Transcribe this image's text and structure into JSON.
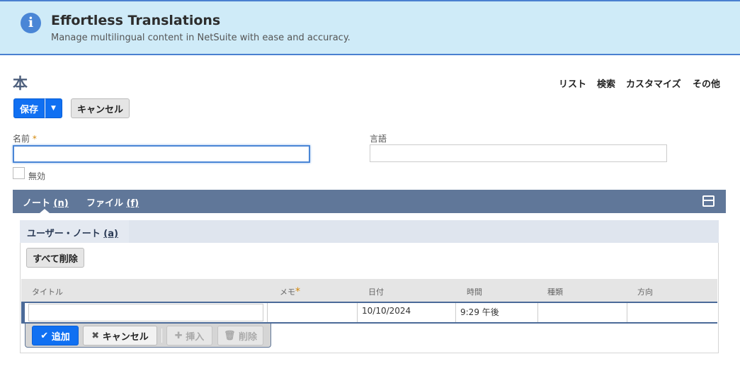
{
  "banner": {
    "title": "Effortless Translations",
    "subtitle": "Manage multilingual content in NetSuite with ease and accuracy."
  },
  "page": {
    "title": "本"
  },
  "nav": {
    "list": "リスト",
    "search": "検索",
    "customize": "カスタマイズ",
    "more": "その他"
  },
  "toolbar": {
    "save": "保存",
    "cancel": "キャンセル"
  },
  "form": {
    "name_label": "名前",
    "name_value": "",
    "language_label": "言語",
    "language_value": "",
    "inactive_label": "無効",
    "required_mark": "*"
  },
  "tabs": [
    {
      "label": "ノート",
      "key": "(n)"
    },
    {
      "label": "ファイル",
      "key": "(f)"
    }
  ],
  "subtabs": [
    {
      "label": "ユーザー・ノート",
      "key": "(a)"
    }
  ],
  "notes": {
    "remove_all": "すべて削除",
    "columns": [
      "タイトル",
      "メモ",
      "日付",
      "時間",
      "種類",
      "方向"
    ],
    "row": {
      "title": "",
      "memo": "",
      "date": "10/10/2024",
      "time": "9:29 午後",
      "type": "",
      "direction": ""
    },
    "actions": {
      "add": "追加",
      "cancel": "キャンセル",
      "insert": "挿入",
      "remove": "削除"
    }
  },
  "colors": {
    "accent": "#1070f2",
    "tabbar": "#607799",
    "banner": "#cfebf8"
  }
}
